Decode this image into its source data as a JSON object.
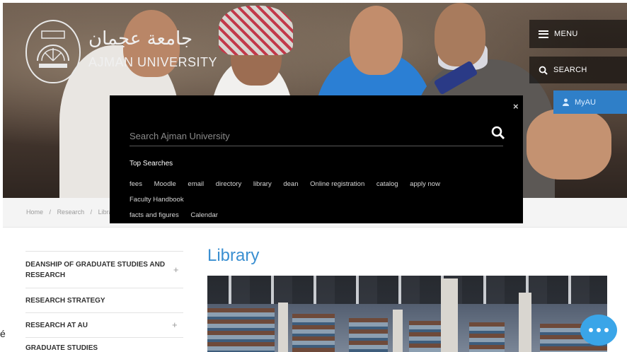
{
  "brand": {
    "arabic_name": "جامعة عجمان",
    "english_name": "AJMAN UNIVERSITY"
  },
  "nav": {
    "menu_label": "MENU",
    "search_label": "SEARCH",
    "myau_label": "MyAU"
  },
  "breadcrumb": {
    "items": [
      "Home",
      "/",
      "Research",
      "/",
      "Libra"
    ]
  },
  "search_overlay": {
    "placeholder": "Search Ajman University",
    "top_searches_title": "Top Searches",
    "tags": [
      "fees",
      "Moodle",
      "email",
      "directory",
      "library",
      "dean",
      "Online registration",
      "catalog",
      "apply now",
      "Faculty Handbook",
      "facts and figures",
      "Calendar"
    ],
    "close_label": "×"
  },
  "sidebar": {
    "items": [
      {
        "label": "DEANSHIP OF GRADUATE STUDIES AND RESEARCH",
        "expander": "+"
      },
      {
        "label": "RESEARCH STRATEGY",
        "expander": ""
      },
      {
        "label": "RESEARCH AT AU",
        "expander": "+"
      },
      {
        "label": "GRADUATE STUDIES",
        "expander": ""
      }
    ]
  },
  "main": {
    "title": "Library"
  },
  "edge_glyph": "é",
  "colors": {
    "accent": "#3a8fd1",
    "myau_bg": "#2f7fc8",
    "chat": "#3aa5e8",
    "overlay": "#000000"
  },
  "icons": [
    "hamburger-icon",
    "search-icon",
    "user-icon",
    "close-icon",
    "plus-icon",
    "chat-icon"
  ]
}
